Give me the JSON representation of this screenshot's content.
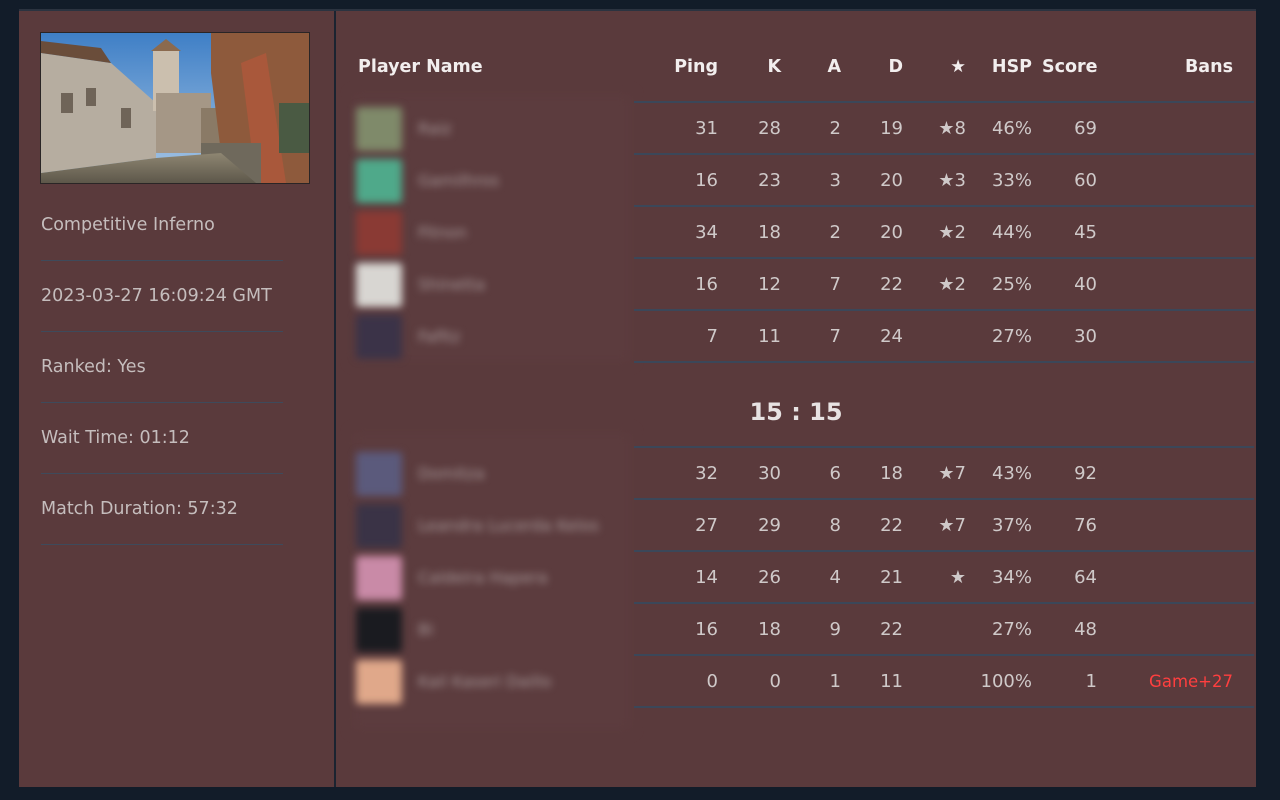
{
  "sidebar": {
    "map_name": "Competitive Inferno",
    "date": "2023-03-27 16:09:24 GMT",
    "ranked": "Ranked: Yes",
    "wait_time": "Wait Time: 01:12",
    "duration": "Match Duration: 57:32"
  },
  "table": {
    "headers": {
      "player_name": "Player Name",
      "ping": "Ping",
      "k": "K",
      "a": "A",
      "d": "D",
      "mvp": "★",
      "hsp": "HSP",
      "score": "Score",
      "bans": "Bans"
    },
    "team1": [
      {
        "name": "Raiz",
        "ping": "31",
        "k": "28",
        "a": "2",
        "d": "19",
        "mvp": "★8",
        "hsp": "46%",
        "score": "69",
        "bans": "",
        "avatar": "#7f8a6a"
      },
      {
        "name": "Gamilhros",
        "ping": "16",
        "k": "23",
        "a": "3",
        "d": "20",
        "mvp": "★3",
        "hsp": "33%",
        "score": "60",
        "bans": "",
        "avatar": "#4fa98a"
      },
      {
        "name": "Fitnon",
        "ping": "34",
        "k": "18",
        "a": "2",
        "d": "20",
        "mvp": "★2",
        "hsp": "44%",
        "score": "45",
        "bans": "",
        "avatar": "#8a3a34"
      },
      {
        "name": "Shinetta",
        "ping": "16",
        "k": "12",
        "a": "7",
        "d": "22",
        "mvp": "★2",
        "hsp": "25%",
        "score": "40",
        "bans": "",
        "avatar": "#d8d6d2"
      },
      {
        "name": "Fafitz",
        "ping": "7",
        "k": "11",
        "a": "7",
        "d": "24",
        "mvp": "",
        "hsp": "27%",
        "score": "30",
        "bans": "",
        "avatar": "#3b3348"
      }
    ],
    "score": "15 : 15",
    "team2": [
      {
        "name": "Domitza",
        "ping": "32",
        "k": "30",
        "a": "6",
        "d": "18",
        "mvp": "★7",
        "hsp": "43%",
        "score": "92",
        "bans": "",
        "avatar": "#5b5a7c"
      },
      {
        "name": "Leandra Lucerda Kelos",
        "ping": "27",
        "k": "29",
        "a": "8",
        "d": "22",
        "mvp": "★7",
        "hsp": "37%",
        "score": "76",
        "bans": "",
        "avatar": "#3a3346"
      },
      {
        "name": "Caldeira Hapera",
        "ping": "14",
        "k": "26",
        "a": "4",
        "d": "21",
        "mvp": "★",
        "hsp": "34%",
        "score": "64",
        "bans": "",
        "avatar": "#c98aa7"
      },
      {
        "name": "Bi",
        "ping": "16",
        "k": "18",
        "a": "9",
        "d": "22",
        "mvp": "",
        "hsp": "27%",
        "score": "48",
        "bans": "",
        "avatar": "#1a1b20"
      },
      {
        "name": "Kail Kaseri Daillo",
        "ping": "0",
        "k": "0",
        "a": "1",
        "d": "11",
        "mvp": "",
        "hsp": "100%",
        "score": "1",
        "bans": "Game+27",
        "avatar": "#e0a88a"
      }
    ]
  }
}
